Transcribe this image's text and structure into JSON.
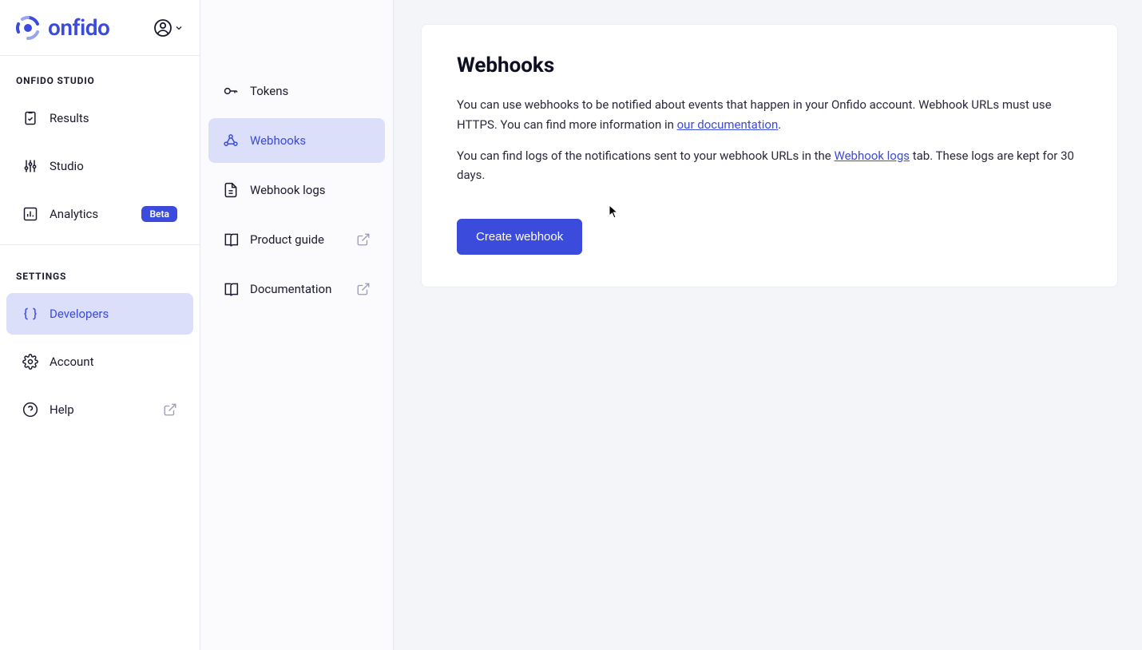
{
  "brand": "onfido",
  "sidebar": {
    "sections": [
      {
        "header": "ONFIDO STUDIO",
        "items": [
          {
            "label": "Results",
            "icon": "clipboard-check-icon"
          },
          {
            "label": "Studio",
            "icon": "sliders-icon"
          },
          {
            "label": "Analytics",
            "icon": "bar-chart-icon",
            "badge": "Beta"
          }
        ]
      },
      {
        "header": "SETTINGS",
        "items": [
          {
            "label": "Developers",
            "icon": "braces-icon",
            "active": true
          },
          {
            "label": "Account",
            "icon": "gear-icon"
          },
          {
            "label": "Help",
            "icon": "help-circle-icon",
            "external": true
          }
        ]
      }
    ]
  },
  "sub_sidebar": {
    "items": [
      {
        "label": "Tokens",
        "icon": "key-icon"
      },
      {
        "label": "Webhooks",
        "icon": "webhook-icon",
        "active": true
      },
      {
        "label": "Webhook logs",
        "icon": "file-text-icon"
      },
      {
        "label": "Product guide",
        "icon": "book-icon",
        "external": true
      },
      {
        "label": "Documentation",
        "icon": "book-icon",
        "external": true
      }
    ]
  },
  "main": {
    "title": "Webhooks",
    "para1_a": "You can use webhooks to be notified about events that happen in your Onfido account. Webhook URLs must use HTTPS. You can find more information in ",
    "para1_link": "our documentation",
    "para1_b": ".",
    "para2_a": "You can find logs of the notifications sent to your webhook URLs in the ",
    "para2_link": "Webhook logs",
    "para2_b": " tab. These logs are kept for 30 days.",
    "create_button": "Create webhook"
  }
}
